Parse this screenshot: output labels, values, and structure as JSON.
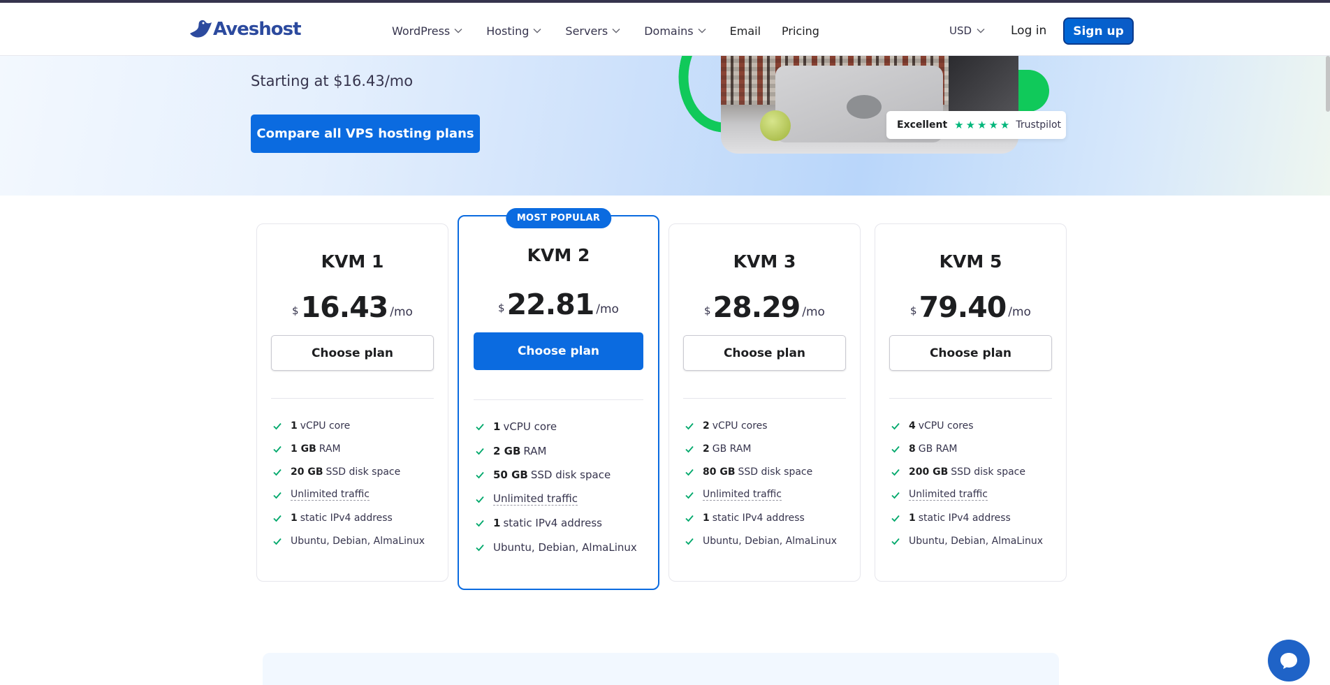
{
  "brand": {
    "name": "Aveshost",
    "color": "#2c4a9e"
  },
  "nav": {
    "items": [
      {
        "label": "WordPress",
        "dropdown": true
      },
      {
        "label": "Hosting",
        "dropdown": true
      },
      {
        "label": "Servers",
        "dropdown": true
      },
      {
        "label": "Domains",
        "dropdown": true
      },
      {
        "label": "Email",
        "dropdown": false
      },
      {
        "label": "Pricing",
        "dropdown": false
      }
    ],
    "currency": "USD",
    "login": "Log in",
    "signup": "Sign up"
  },
  "hero": {
    "subtitle": "Starting at $16.43/mo",
    "cta": "Compare all VPS hosting plans",
    "trustpilot": {
      "rating_word": "Excellent",
      "stars": "★★★★★",
      "name": "Trustpilot"
    }
  },
  "plans": [
    {
      "name": "KVM 1",
      "currency": "$",
      "price": "16.43",
      "period": "/mo",
      "cta": "Choose plan",
      "popular": false,
      "features": [
        {
          "value": "1",
          "text": "vCPU core"
        },
        {
          "value": "1 GB",
          "text": "RAM"
        },
        {
          "value": "20 GB",
          "text": "SSD disk space"
        },
        {
          "value": "",
          "text": "Unlimited traffic"
        },
        {
          "value": "1",
          "text": "static IPv4 address"
        },
        {
          "value": "",
          "text": "Ubuntu, Debian, AlmaLinux"
        }
      ]
    },
    {
      "name": "KVM 2",
      "currency": "$",
      "price": "22.81",
      "period": "/mo",
      "cta": "Choose plan",
      "popular": true,
      "badge": "MOST POPULAR",
      "features": [
        {
          "value": "1",
          "text": "vCPU core"
        },
        {
          "value": "2 GB",
          "text": "RAM"
        },
        {
          "value": "50 GB",
          "text": "SSD disk space"
        },
        {
          "value": "",
          "text": "Unlimited traffic"
        },
        {
          "value": "1",
          "text": "static IPv4 address"
        },
        {
          "value": "",
          "text": "Ubuntu, Debian, AlmaLinux"
        }
      ]
    },
    {
      "name": "KVM 3",
      "currency": "$",
      "price": "28.29",
      "period": "/mo",
      "cta": "Choose plan",
      "popular": false,
      "features": [
        {
          "value": "2",
          "text": "vCPU cores"
        },
        {
          "value": "2",
          "text": "GB RAM"
        },
        {
          "value": "80 GB",
          "text": "SSD disk space"
        },
        {
          "value": "",
          "text": "Unlimited traffic"
        },
        {
          "value": "1",
          "text": "static IPv4 address"
        },
        {
          "value": "",
          "text": "Ubuntu, Debian, AlmaLinux"
        }
      ]
    },
    {
      "name": "KVM 5",
      "currency": "$",
      "price": "79.40",
      "period": "/mo",
      "cta": "Choose plan",
      "popular": false,
      "features": [
        {
          "value": "4",
          "text": "vCPU cores"
        },
        {
          "value": "8",
          "text": "GB RAM"
        },
        {
          "value": "200 GB",
          "text": "SSD disk space"
        },
        {
          "value": "",
          "text": "Unlimited traffic"
        },
        {
          "value": "1",
          "text": "static IPv4 address"
        },
        {
          "value": "",
          "text": "Ubuntu, Debian, AlmaLinux"
        }
      ]
    }
  ],
  "colors": {
    "accent": "#0b6be0",
    "check": "#00a86b",
    "trustpilot": "#00b67a"
  }
}
